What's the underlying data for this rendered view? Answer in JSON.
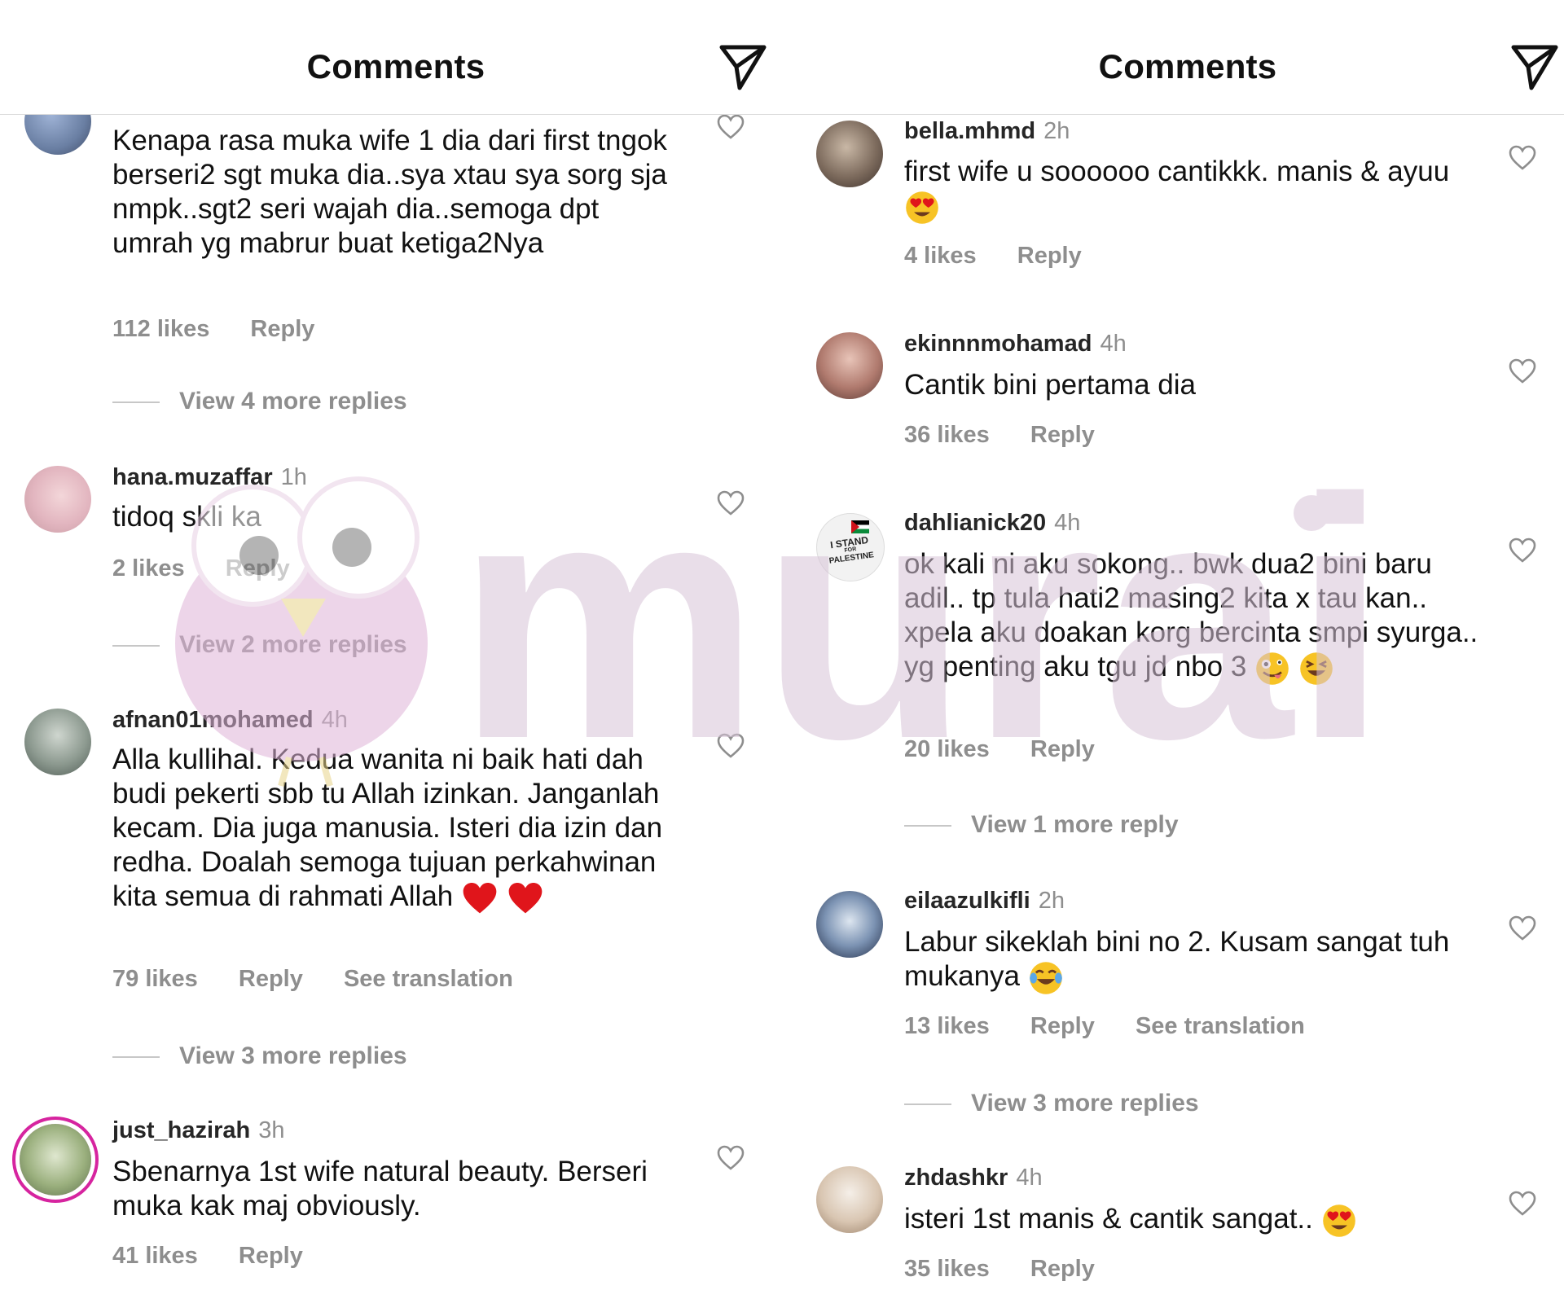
{
  "left": {
    "header": {
      "title": "Comments"
    },
    "comments": [
      {
        "username": "",
        "time": "",
        "text": "Kenapa rasa muka wife 1 dia dari first tngok berseri2 sgt muka dia..sya xtau sya sorg sja nmpk..sgt2 seri wajah dia..semoga dpt umrah yg mabrur buat ketiga2Nya",
        "likes": "112 likes",
        "reply": "Reply",
        "view_more": "View 4 more replies"
      },
      {
        "username": "hana.muzaffar",
        "time": "1h",
        "text": "tidoq skli ka",
        "likes": "2 likes",
        "reply": "Reply",
        "view_more": "View 2 more replies"
      },
      {
        "username": "afnan01mohamed",
        "time": "4h",
        "text": "Alla kullihal. Kedua wanita ni baik hati dah budi pekerti sbb tu Allah izinkan. Janganlah kecam. Dia juga manusia. Isteri dia izin dan redha. Doalah semoga tujuan perkahwinan kita semua di rahmati Allah",
        "likes": "79 likes",
        "reply": "Reply",
        "see_translation": "See translation",
        "view_more": "View 3 more replies"
      },
      {
        "username": "just_hazirah",
        "time": "3h",
        "text": "Sbenarnya 1st wife natural beauty. Berseri muka kak maj obviously.",
        "likes": "41 likes",
        "reply": "Reply"
      }
    ]
  },
  "right": {
    "header": {
      "title": "Comments"
    },
    "comments": [
      {
        "username": "bella.mhmd",
        "time": "2h",
        "text": "first wife u soooooo cantikkk. manis & ayuu",
        "likes": "4 likes",
        "reply": "Reply"
      },
      {
        "username": "ekinnnmohamad",
        "time": "4h",
        "text": "Cantik bini pertama dia",
        "likes": "36 likes",
        "reply": "Reply"
      },
      {
        "username": "dahlianick20",
        "time": "4h",
        "text": "ok kali ni aku sokong.. bwk dua2 bini baru adil.. tp tula hati2 masing2 kita x tau kan.. xpela aku doakan korg bercinta smpi syurga.. yg penting aku tgu jd nbo 3",
        "likes": "20 likes",
        "reply": "Reply",
        "view_more": "View 1 more reply",
        "avatar_text_1": "I STAND",
        "avatar_text_2": "FOR",
        "avatar_text_3": "PALESTINE"
      },
      {
        "username": "eilaazulkifli",
        "time": "2h",
        "text": "Labur sikeklah bini no 2. Kusam sangat tuh mukanya",
        "likes": "13 likes",
        "reply": "Reply",
        "see_translation": "See translation",
        "view_more": "View 3 more replies"
      },
      {
        "username": "zhdashkr",
        "time": "4h",
        "text": "isteri 1st manis & cantik sangat..",
        "likes": "35 likes",
        "reply": "Reply"
      }
    ]
  },
  "watermark": {
    "text": "murai",
    "color": "#dcc7dc"
  },
  "colors": {
    "muted": "#8e8e8e",
    "divider": "#dbdbdb",
    "story_ring": "#d6249f",
    "heart_red": "#e0151b",
    "emoji_yellow": "#f7c325"
  }
}
